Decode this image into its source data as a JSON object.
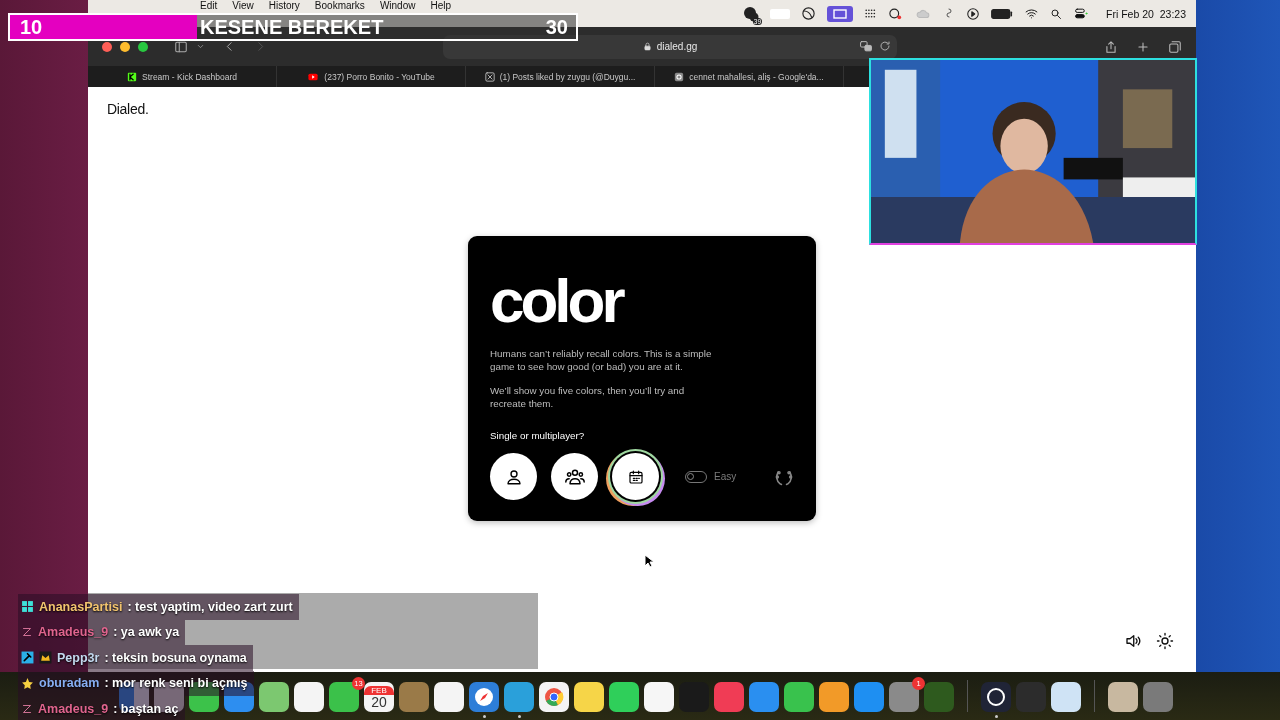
{
  "stream_goal": {
    "count": "10",
    "title": "KESENE BEREKET",
    "target": "30",
    "level": 0.33
  },
  "menu_bar": {
    "menus": [
      "Edit",
      "View",
      "History",
      "Bookmarks",
      "Window",
      "Help"
    ],
    "status_badge": "39",
    "clock": "Fri Feb 20  23:23"
  },
  "browser": {
    "url": "dialed.gg",
    "tabs": [
      {
        "kind": "kick",
        "title": "Stream - Kick Dashboard",
        "selected": false
      },
      {
        "kind": "youtube",
        "title": "(237) Porro Bonito - YouTube",
        "selected": false
      },
      {
        "kind": "x",
        "title": "(1) Posts liked by zuygu (@Duygu...",
        "selected": false
      },
      {
        "kind": "google",
        "title": "cennet mahallesi, aliş - Google'da...",
        "selected": false
      }
    ]
  },
  "page": {
    "brand": "Dialed.",
    "card": {
      "title": "color",
      "paragraphs": [
        "Humans can’t reliably recall colors. This is a simple game to see how good (or bad) you are at it.",
        "We’ll show you five colors, then you’ll try and recreate them."
      ],
      "question": "Single or multiplayer?",
      "modes": [
        {
          "kind": "single",
          "selected": false
        },
        {
          "kind": "multi",
          "selected": false
        },
        {
          "kind": "daily",
          "selected": true
        }
      ],
      "easy": {
        "label": "Easy",
        "on": false
      }
    }
  },
  "chat": [
    {
      "kind": "og",
      "user": "AnanasPartisi",
      "color": "#f2c46e",
      "message": ": test yaptim, video zart zurt"
    },
    {
      "kind": "z",
      "user": "Amadeus_9",
      "color": "#e0648e",
      "message": ": ya awk ya"
    },
    {
      "kind": "mod",
      "user": "Pepp3r",
      "color": "#c2d8ee",
      "message": ": teksin bosuna oynama"
    },
    {
      "kind": "star",
      "user": "oburadam",
      "color": "#86aef2",
      "message": ": mor renk seni bi açmış"
    },
    {
      "kind": "z",
      "user": "Amadeus_9",
      "color": "#e0648e",
      "message": ": baştan aç"
    }
  ],
  "dock": [
    {
      "kind": "finder",
      "running": false
    },
    {
      "kind": "launchpad",
      "running": false
    },
    {
      "kind": "messages",
      "running": false
    },
    {
      "kind": "mail",
      "running": false
    },
    {
      "kind": "maps",
      "running": false
    },
    {
      "kind": "photos",
      "running": false
    },
    {
      "kind": "facetime",
      "running": false,
      "badge": "13"
    },
    {
      "kind": "calendar",
      "running": false,
      "month": "FEB",
      "day": "20"
    },
    {
      "kind": "book",
      "running": false
    },
    {
      "kind": "reminders",
      "running": false
    },
    {
      "kind": "safari",
      "running": true
    },
    {
      "kind": "telegram",
      "running": true
    },
    {
      "kind": "chrome",
      "running": false
    },
    {
      "kind": "notes",
      "running": false
    },
    {
      "kind": "whatsapp",
      "running": false
    },
    {
      "kind": "freeform",
      "running": false
    },
    {
      "kind": "tv",
      "running": false
    },
    {
      "kind": "music",
      "running": false
    },
    {
      "kind": "keynote",
      "running": false
    },
    {
      "kind": "numbers",
      "running": false
    },
    {
      "kind": "pages",
      "running": false
    },
    {
      "kind": "appstore",
      "running": false
    },
    {
      "kind": "settings",
      "running": false,
      "badge": "1"
    },
    {
      "kind": "globe",
      "running": false
    },
    {
      "kind": "divider"
    },
    {
      "kind": "obs",
      "running": true
    },
    {
      "kind": "quicktime",
      "running": false
    },
    {
      "kind": "preview",
      "running": false
    },
    {
      "kind": "divider"
    },
    {
      "kind": "stack",
      "running": false
    },
    {
      "kind": "trash",
      "running": false
    }
  ]
}
